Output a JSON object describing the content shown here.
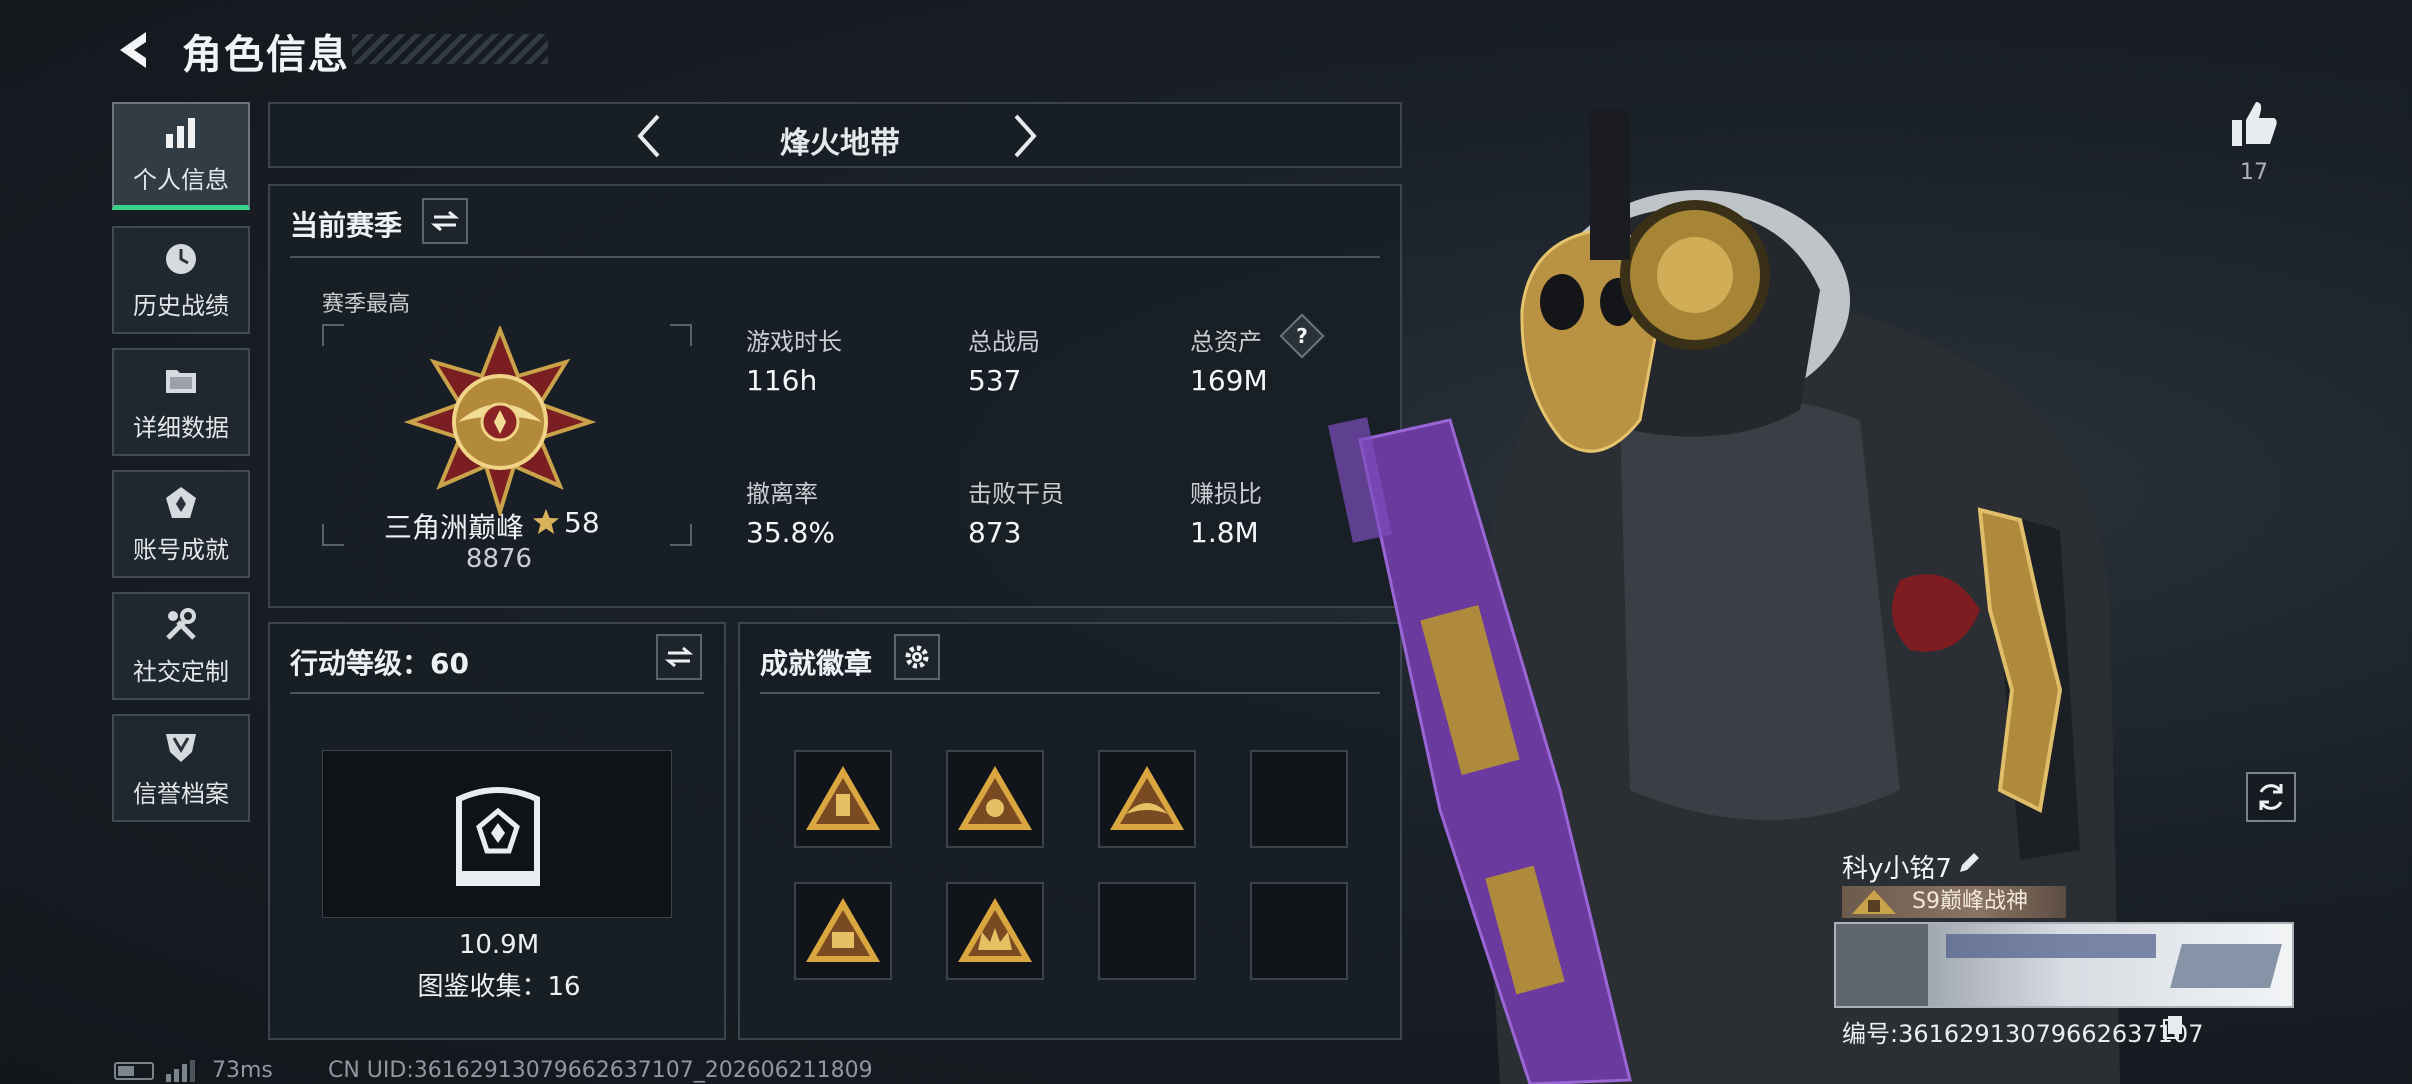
{
  "header": {
    "title": "角色信息"
  },
  "sidebar": {
    "items": [
      {
        "label": "个人信息",
        "icon": "bar-chart-icon",
        "active": true
      },
      {
        "label": "历史战绩",
        "icon": "history-clock-icon",
        "active": false
      },
      {
        "label": "详细数据",
        "icon": "folder-icon",
        "active": false
      },
      {
        "label": "账号成就",
        "icon": "achievement-icon",
        "active": false
      },
      {
        "label": "社交定制",
        "icon": "wrench-icon",
        "active": false
      },
      {
        "label": "信誉档案",
        "icon": "shield-icon",
        "active": false
      }
    ]
  },
  "mode_selector": {
    "label": "烽火地带"
  },
  "season_panel": {
    "title": "当前赛季",
    "best_label": "赛季最高",
    "rank_name": "三角洲巅峰",
    "rank_stars": "58",
    "rank_score": "8876",
    "stats": [
      {
        "label": "游戏时长",
        "value": "116h"
      },
      {
        "label": "总战局",
        "value": "537"
      },
      {
        "label": "总资产",
        "value": "169M",
        "help": "?"
      },
      {
        "label": "撤离率",
        "value": "35.8%"
      },
      {
        "label": "击败干员",
        "value": "873"
      },
      {
        "label": "赚损比",
        "value": "1.8M"
      }
    ]
  },
  "action_level_panel": {
    "title": "行动等级：60",
    "value": "10.9M",
    "collection": "图鉴收集：16"
  },
  "badge_panel": {
    "title": "成就徽章",
    "badges": [
      {
        "icon": "gold-triangle-badge-icon",
        "filled": true
      },
      {
        "icon": "gold-triangle-badge-icon",
        "filled": true
      },
      {
        "icon": "gold-wings-badge-icon",
        "filled": true
      },
      {
        "icon": "",
        "filled": false
      },
      {
        "icon": "gold-s8-badge-icon",
        "filled": true
      },
      {
        "icon": "gold-crown-badge-icon",
        "filled": true
      },
      {
        "icon": "",
        "filled": false
      },
      {
        "icon": "",
        "filled": false
      }
    ]
  },
  "profile": {
    "likes": "17",
    "player_name": "科y小铭7",
    "title_tag": "S9巅峰战神",
    "serial": "编号:3616291307966263710​7"
  },
  "footer": {
    "ping": "73ms",
    "uid": "CN UID:3616291307966263710​7_202606211809"
  },
  "colors": {
    "accent_green": "#39d28a",
    "gold": "#c9a24a",
    "panel_bg": "#181e25"
  }
}
